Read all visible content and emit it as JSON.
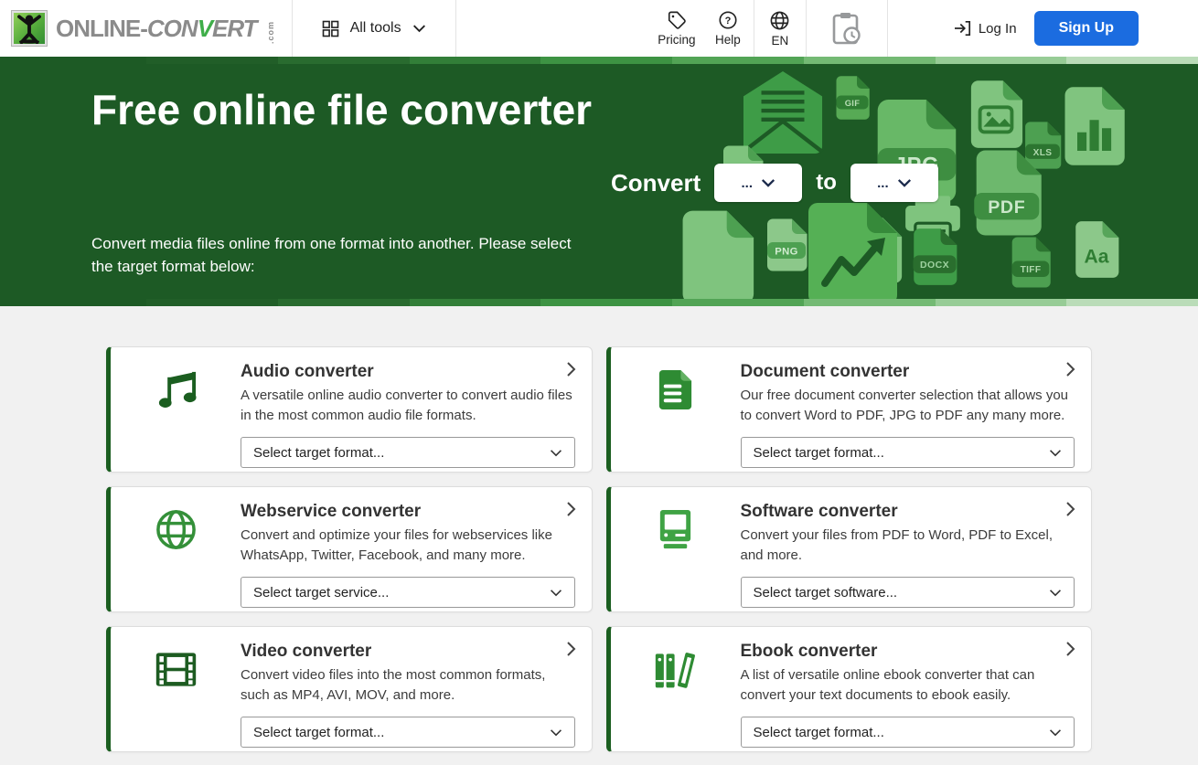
{
  "header": {
    "logo": {
      "brand_gray": "ONLINE",
      "brand_dash": "-",
      "brand_italic_pre": "CON",
      "brand_italic_v": "V",
      "brand_italic_post": "ERT",
      "brand_tld": ".com"
    },
    "nav": {
      "all_tools": "All tools",
      "pricing": "Pricing",
      "help": "Help",
      "language": "EN",
      "login": "Log In",
      "signup": "Sign Up"
    }
  },
  "hero": {
    "title": "Free online file converter",
    "subtitle": "Convert media files online from one format into another. Please select the target format below:",
    "convert_label": "Convert",
    "to_label": "to",
    "from_placeholder": "...",
    "to_placeholder": "...",
    "file_badges": {
      "gif": "GIF",
      "jpg": "JPG",
      "xls": "XLS",
      "pdf": "PDF",
      "png": "PNG",
      "docx": "DOCX",
      "tiff": "TIFF",
      "aa": "Aa"
    }
  },
  "cards": [
    {
      "title": "Audio converter",
      "description": "A versatile online audio converter to convert audio files in the most common audio file formats.",
      "select_label": "Select target format..."
    },
    {
      "title": "Document converter",
      "description": "Our free document converter selection that allows you to convert Word to PDF, JPG to PDF any many more.",
      "select_label": "Select target format..."
    },
    {
      "title": "Webservice converter",
      "description": "Convert and optimize your files for webservices like WhatsApp, Twitter, Facebook, and many more.",
      "select_label": "Select target service..."
    },
    {
      "title": "Software converter",
      "description": "Convert your files from PDF to Word, PDF to Excel, and more.",
      "select_label": "Select target software..."
    },
    {
      "title": "Video converter",
      "description": "Convert video files into the most common formats, such as MP4, AVI, MOV, and more.",
      "select_label": "Select target format..."
    },
    {
      "title": "Ebook converter",
      "description": "A list of versatile online ebook converter that can convert your text documents to ebook easily.",
      "select_label": "Select target format..."
    }
  ],
  "colors": {
    "brand_green_dark": "#1b5e20",
    "hero_background": "#1d5a25",
    "signup_blue": "#1b6ce0",
    "stripe_gradient": [
      "#215e28",
      "#296b2f",
      "#327e38",
      "#3d9343",
      "#52a455",
      "#74ba74",
      "#97cc96",
      "#badcb8"
    ]
  }
}
